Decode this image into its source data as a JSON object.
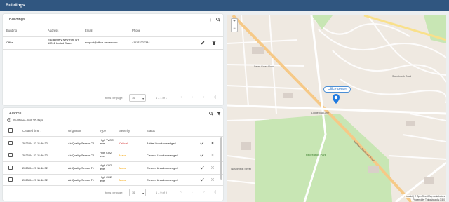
{
  "header": {
    "title": "Buildings"
  },
  "buildings": {
    "title": "Buildings",
    "columns": {
      "building": "Building",
      "address": "Address",
      "email": "Email",
      "phone": "Phone"
    },
    "rows": [
      {
        "building": "Office",
        "address_line1": "246 Bowery New York NY",
        "address_line2": "10012 United States",
        "email": "support@office-center.com",
        "phone": "+11122223334"
      }
    ],
    "pager": {
      "items_per_page_label": "Items per page:",
      "page_size": "10",
      "range": "1 – 1 of 1"
    }
  },
  "alarms": {
    "title": "Alarms",
    "filter_label": "Realtime - last 30 days",
    "columns": {
      "created": "Created time",
      "originator": "Originator",
      "type": "Type",
      "severity": "Severity",
      "status": "Status"
    },
    "rows": [
      {
        "created": "2023-04-27 11:46:32",
        "originator": "Air Quality Sensor C1",
        "type_line1": "High TVOC",
        "type_line2": "level",
        "severity": "Critical",
        "severity_level": "critical",
        "status": "Active Unacknowledged"
      },
      {
        "created": "2023-04-27 11:46:32",
        "originator": "Air Quality Sensor C1",
        "type_line1": "High CO2",
        "type_line2": "level",
        "severity": "Major",
        "severity_level": "major",
        "status": "Cleared Unacknowledged"
      },
      {
        "created": "2023-04-27 11:46:32",
        "originator": "Air Quality Sensor T1",
        "type_line1": "High CO2",
        "type_line2": "level",
        "severity": "Major",
        "severity_level": "major",
        "status": "Cleared Unacknowledged"
      },
      {
        "created": "2023-04-27 11:46:32",
        "originator": "Air Quality Sensor T1",
        "type_line1": "High CO2",
        "type_line2": "level",
        "severity": "Major",
        "severity_level": "major",
        "status": "Cleared Unacknowledged"
      }
    ],
    "pager": {
      "items_per_page_label": "Items per page:",
      "page_size": "10",
      "range": "1 – 9 of 9"
    }
  },
  "map": {
    "zoom_in": "+",
    "zoom_out": "−",
    "marker_label": "Office center",
    "street_labels": [
      "Sever Creek Road",
      "Lodgebow Lane",
      "Stonebrook Road",
      "Highland Boulevard Road",
      "Recreation Park",
      "Washington Street"
    ],
    "attribution_line1": "Leaflet | © OpenStreetMap contributors",
    "attribution_line2": "Powered by Thingsboard v.3.5.0"
  },
  "colors": {
    "header": "#305680",
    "critical": "#d32f2f",
    "major": "#f5a300",
    "park": "#c8e6b4"
  }
}
